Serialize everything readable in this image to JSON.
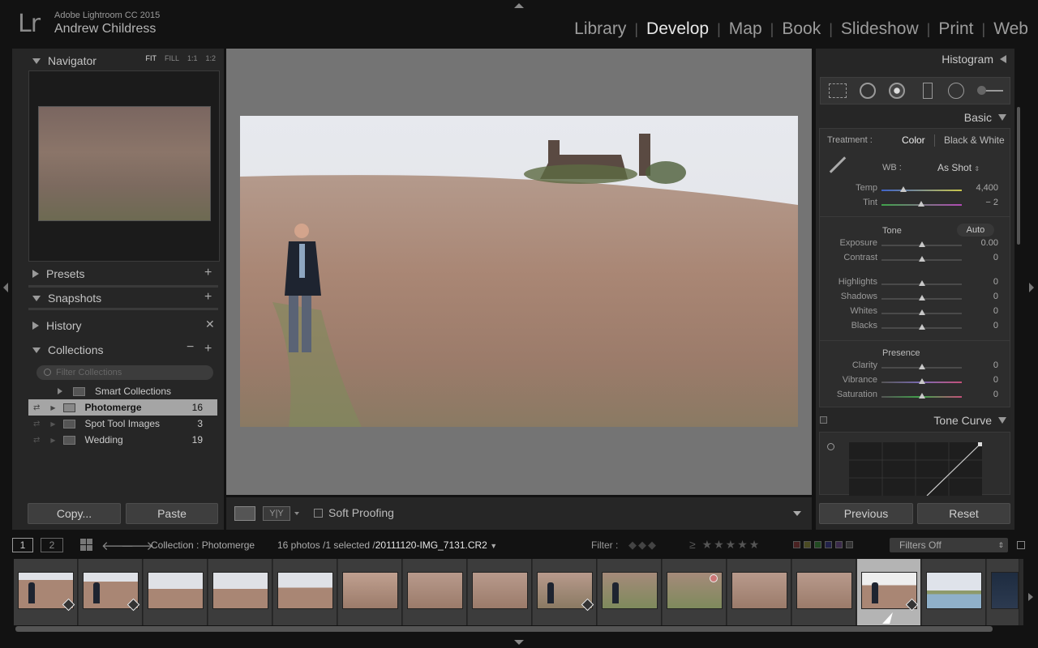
{
  "app": {
    "name": "Adobe Lightroom CC 2015",
    "user": "Andrew Childress",
    "logo": "Lr"
  },
  "modules": [
    {
      "label": "Library",
      "active": false
    },
    {
      "label": "Develop",
      "active": true
    },
    {
      "label": "Map",
      "active": false
    },
    {
      "label": "Book",
      "active": false
    },
    {
      "label": "Slideshow",
      "active": false
    },
    {
      "label": "Print",
      "active": false
    },
    {
      "label": "Web",
      "active": false
    }
  ],
  "left": {
    "navigator": {
      "title": "Navigator",
      "options": [
        "FIT",
        "FILL",
        "1:1",
        "1:2"
      ]
    },
    "presets": "Presets",
    "snapshots": "Snapshots",
    "history": "History",
    "collections": {
      "title": "Collections",
      "filter_placeholder": "Filter Collections",
      "items": [
        {
          "name": "Smart Collections",
          "count": ""
        },
        {
          "name": "Photomerge",
          "count": "16"
        },
        {
          "name": "Spot Tool Images",
          "count": "3"
        },
        {
          "name": "Wedding",
          "count": "19"
        }
      ]
    },
    "copy_label": "Copy...",
    "paste_label": "Paste"
  },
  "toolbar": {
    "soft_proofing": "Soft Proofing"
  },
  "right": {
    "histogram": "Histogram",
    "basic": "Basic",
    "treatment_label": "Treatment :",
    "treatment_color": "Color",
    "treatment_bw": "Black & White",
    "wb_label": "WB :",
    "wb_value": "As Shot",
    "temp": {
      "label": "Temp",
      "value": "4,400"
    },
    "tint": {
      "label": "Tint",
      "value": "− 2"
    },
    "tone_label": "Tone",
    "auto_label": "Auto",
    "exposure": {
      "label": "Exposure",
      "value": "0.00"
    },
    "contrast": {
      "label": "Contrast",
      "value": "0"
    },
    "highlights": {
      "label": "Highlights",
      "value": "0"
    },
    "shadows": {
      "label": "Shadows",
      "value": "0"
    },
    "whites": {
      "label": "Whites",
      "value": "0"
    },
    "blacks": {
      "label": "Blacks",
      "value": "0"
    },
    "presence_label": "Presence",
    "clarity": {
      "label": "Clarity",
      "value": "0"
    },
    "vibrance": {
      "label": "Vibrance",
      "value": "0"
    },
    "saturation": {
      "label": "Saturation",
      "value": "0"
    },
    "tone_curve": "Tone Curve",
    "previous_label": "Previous",
    "reset_label": "Reset"
  },
  "filmbar": {
    "screen1": "1",
    "screen2": "2",
    "collection": "Collection : Photomerge",
    "info": "16 photos /1 selected /",
    "filename": "20111120-IMG_7131.CR2",
    "filter_label": "Filter :",
    "filters_value": "Filters Off"
  },
  "colors": {
    "accent": "#e8e8e8",
    "panel": "#262626",
    "background": "#121212"
  }
}
